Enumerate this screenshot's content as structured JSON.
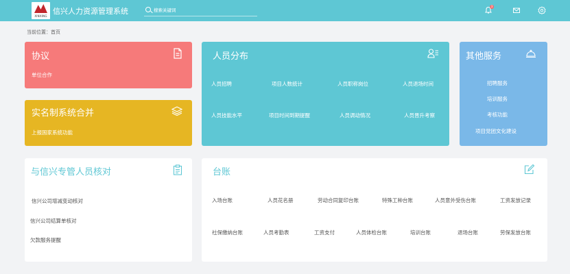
{
  "header": {
    "logo_text": "XINXING",
    "title": "信兴人力资源管理系统",
    "search_placeholder": "搜索关键词",
    "notification_count": "3"
  },
  "breadcrumb": "当前位置：首页",
  "agreement": {
    "title": "协议",
    "links": [
      "单位合作"
    ]
  },
  "realname": {
    "title": "实名制系统合并",
    "links": [
      "上报国家系统功能"
    ]
  },
  "personnel": {
    "title": "人员分布",
    "links": [
      "人员招聘",
      "项目人数统计",
      "人员职称岗位",
      "人员退场时间",
      "人员技能水平",
      "项目时间到期提醒",
      "人员调动情况",
      "人员晋升考察"
    ]
  },
  "other": {
    "title": "其他服务",
    "links": [
      "招聘服务",
      "培训服务",
      "考核功能",
      "项目党团文化建设"
    ]
  },
  "verify": {
    "title": "与信兴专管人员核对",
    "links": [
      "信兴公司增减变动核对",
      "信兴公司结算单核对",
      "欠款服务提醒"
    ]
  },
  "ledger": {
    "title": "台账",
    "links": [
      "入场台账",
      "人员花名册",
      "劳动合同复印台账",
      "特殊工种台账",
      "人员意外受伤台账",
      "工资发放记录",
      "社保缴纳台账",
      "人员考勤表",
      "工资支付",
      "人员体检台账",
      "培训台账",
      "退场台账",
      "劳保发放台账"
    ]
  },
  "colors": {
    "topbar": "#5ec7d4",
    "agreement": "#f67a7a",
    "realname": "#e6b623",
    "personnel": "#5ec7d4",
    "other": "#7ab8e8"
  }
}
